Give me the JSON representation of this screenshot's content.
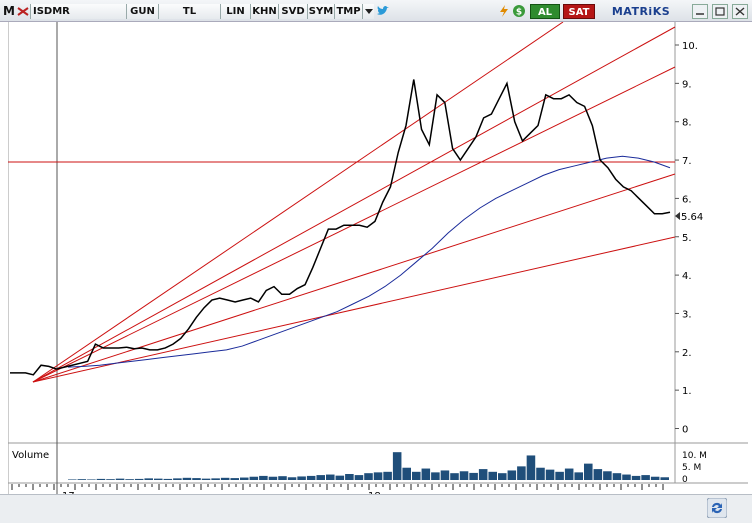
{
  "toolbar": {
    "m_label": "M",
    "symbol": "ISDMR",
    "period": "GUN",
    "currency": "TL",
    "scale": "LIN",
    "khn": "KHN",
    "svd": "SVD",
    "sym": "SYM",
    "tmp": "TMP",
    "buy_label": "AL",
    "sell_label": "SAT",
    "brand": "MATRiKS",
    "icons": [
      "flash-icon",
      "dollar-icon",
      "twitter-icon",
      "dropdown-icon",
      "minimize-icon",
      "restore-icon",
      "close-icon",
      "refresh-icon"
    ]
  },
  "price_axis": {
    "ticks": [
      "0",
      "1.",
      "2.",
      "3.",
      "4.",
      "5.",
      "6.",
      "7.",
      "8.",
      "9.",
      "10."
    ],
    "last_price": "5.64"
  },
  "volume_panel": {
    "label": "Volume",
    "ticks": [
      "10. M",
      "5. M",
      "0"
    ]
  },
  "time_axis": {
    "labels": [
      "17",
      "18"
    ]
  },
  "chart_data": {
    "type": "line",
    "ylim": [
      0,
      10.6
    ],
    "last_value": 5.64,
    "horizontal_line": 7.1,
    "series": [
      {
        "values": [
          1.45,
          1.45,
          1.45,
          1.4,
          1.65,
          1.62,
          1.55,
          1.6,
          1.65,
          1.7,
          1.75,
          2.2,
          2.1,
          2.1,
          2.1,
          2.12,
          2.08,
          2.1,
          2.05,
          2.05,
          2.1,
          2.2,
          2.35,
          2.6,
          2.9,
          3.15,
          3.35,
          3.4,
          3.35,
          3.3,
          3.35,
          3.4,
          3.3,
          3.6,
          3.7,
          3.5,
          3.5,
          3.65,
          3.75,
          4.2,
          4.7,
          5.2,
          5.2,
          5.3,
          5.3,
          5.3,
          5.25,
          5.4,
          5.9,
          6.3,
          7.2,
          7.9,
          9.1,
          7.8,
          7.4,
          8.7,
          8.5,
          7.3,
          7.0,
          7.3,
          7.6,
          8.1,
          8.2,
          8.6,
          9.0,
          8.0,
          7.5,
          7.7,
          7.9,
          8.7,
          8.6,
          8.6,
          8.7,
          8.5,
          8.4,
          7.9,
          7.0,
          6.8,
          6.5,
          6.3,
          6.2,
          6.0,
          5.8,
          5.6,
          5.6,
          5.64
        ]
      },
      {
        "values": [
          1.6,
          1.62,
          1.65,
          1.7,
          1.75,
          1.8,
          1.85,
          1.9,
          1.95,
          2.0,
          2.05,
          2.15,
          2.3,
          2.45,
          2.6,
          2.75,
          2.9,
          3.05,
          3.25,
          3.45,
          3.7,
          4.0,
          4.35,
          4.7,
          5.1,
          5.45,
          5.75,
          6.0,
          6.2,
          6.4,
          6.6,
          6.75,
          6.85,
          6.95,
          7.05,
          7.1,
          7.05,
          6.95,
          6.8
        ]
      }
    ],
    "volume_values": [
      0.2,
      0.3,
      0.2,
      0.4,
      0.3,
      0.5,
      0.3,
      0.4,
      0.6,
      0.5,
      0.4,
      0.6,
      0.8,
      0.7,
      0.5,
      0.6,
      0.8,
      0.7,
      0.9,
      1.2,
      1.5,
      1.2,
      1.4,
      1.0,
      1.3,
      1.5,
      1.8,
      2.0,
      1.6,
      2.2,
      1.8,
      2.5,
      2.8,
      3.0,
      10.2,
      4.5,
      3.0,
      4.2,
      2.8,
      3.5,
      2.5,
      3.2,
      2.6,
      4.0,
      3.0,
      2.5,
      3.5,
      5.0,
      9.0,
      4.5,
      3.8,
      3.0,
      4.2,
      2.8,
      6.0,
      4.0,
      3.2,
      2.5,
      2.0,
      1.5,
      1.8,
      1.2,
      1.0
    ]
  },
  "colors": {
    "price": "#000000",
    "moving_average": "#1a2b9a",
    "trendlines": "#cc1111",
    "volume": "#1f4e7a",
    "accent": "#1a3f8e"
  }
}
